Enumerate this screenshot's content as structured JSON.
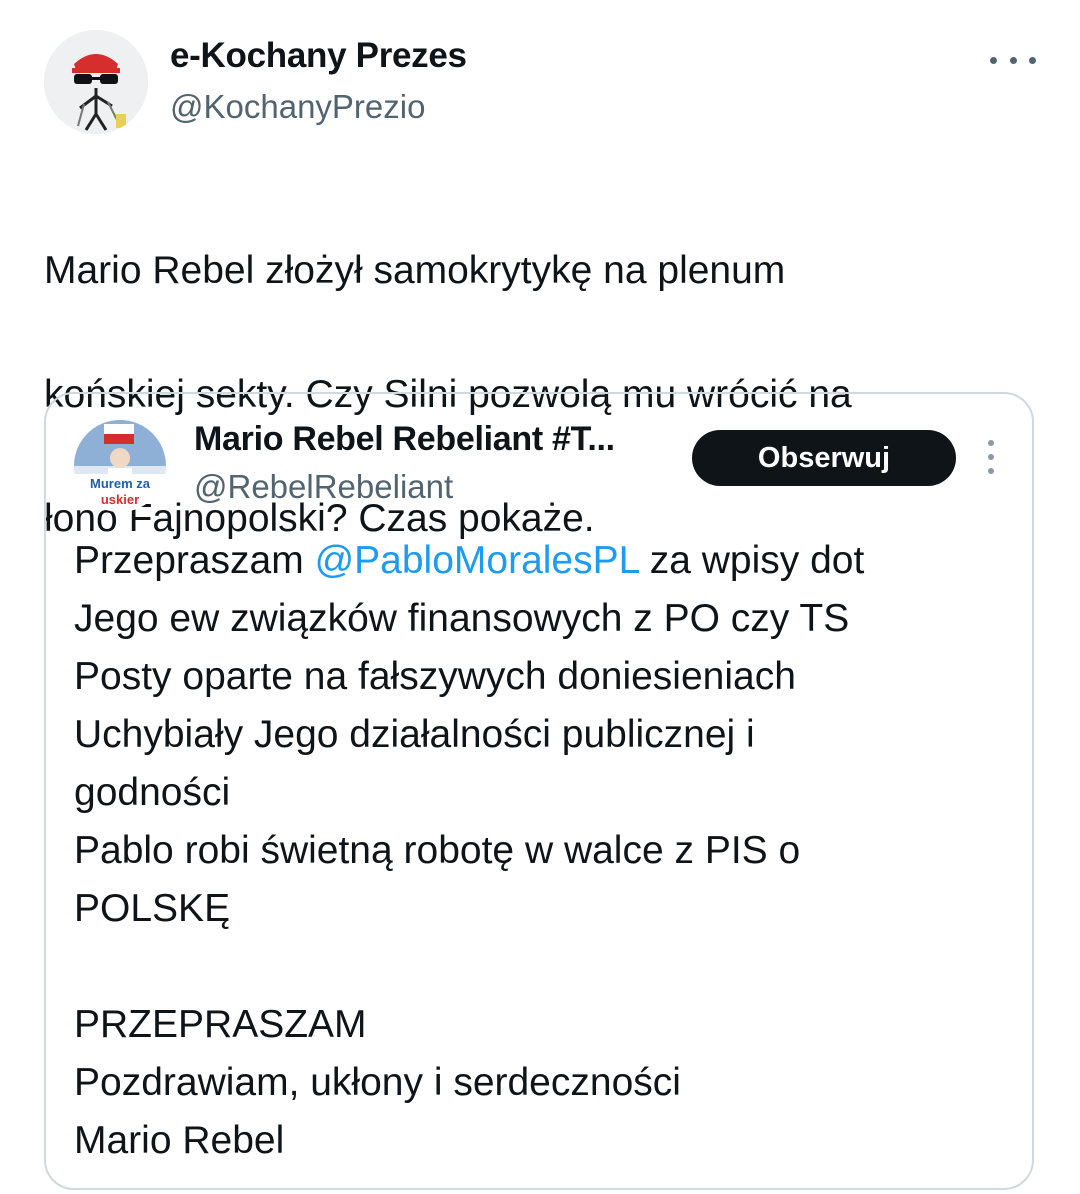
{
  "author": {
    "display_name": "e-Kochany Prezes",
    "handle": "@KochanyPrezio",
    "avatar_icon": "cartoon-avatar-icon"
  },
  "tweet": {
    "text_lines": [
      "Mario Rebel złożył samokrytykę na plenum",
      "końskiej sekty. Czy Silni pozwolą mu wrócić na",
      "łono Fajnopolski? Czas pokaże."
    ]
  },
  "quoted": {
    "display_name": "Mario Rebel Rebeliant #T...",
    "handle": "@RebelRebeliant",
    "avatar_text_top": "Murem za",
    "avatar_text_bottom": "uskier",
    "follow_label": "Obserwuj",
    "body": {
      "line1_prefix": "Przepraszam ",
      "line1_mention": "@PabloMoralesPL",
      "line1_suffix": " za wpisy dot",
      "lines": [
        "Jego ew związków finansowych z PO czy TS",
        "Posty oparte na fałszywych doniesieniach",
        "Uchybiały Jego działalności publicznej i",
        "godności",
        "Pablo robi świetną robotę w walce z PIS o",
        "POLSKĘ",
        "",
        "PRZEPRASZAM",
        "Pozdrawiam, ukłony i serdeczności",
        "Mario Rebel"
      ]
    }
  },
  "colors": {
    "text": "#0f1419",
    "secondary": "#536471",
    "link": "#1d9bf0",
    "border": "#cfd9de",
    "button_bg": "#0f1419"
  }
}
